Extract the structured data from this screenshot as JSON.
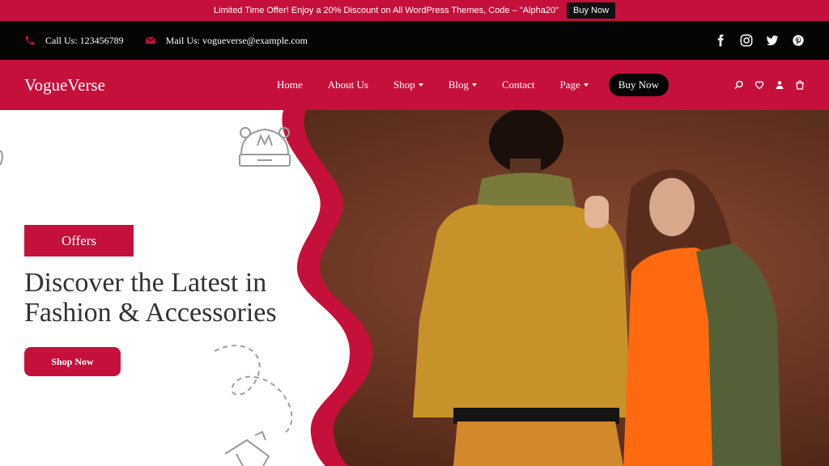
{
  "promo": {
    "text": "Limited Time Offer! Enjoy a 20% Discount on All WordPress Themes, Code – \"Alpha20\"",
    "button": "Buy Now"
  },
  "topbar": {
    "phone": "Call Us: 123456789",
    "email": "Mail Us: vogueverse@example.com",
    "social": [
      "facebook-icon",
      "instagram-icon",
      "twitter-icon",
      "pinterest-icon"
    ]
  },
  "header": {
    "logo": "VogueVerse",
    "nav": [
      {
        "label": "Home"
      },
      {
        "label": "About Us"
      },
      {
        "label": "Shop"
      },
      {
        "label": "Blog"
      },
      {
        "label": "Contact"
      },
      {
        "label": "Page"
      }
    ],
    "cta": "Buy Now",
    "icons": [
      "search-icon",
      "heart-icon",
      "user-icon",
      "cart-icon"
    ]
  },
  "hero": {
    "badge": "Offers",
    "headline": "Discover the Latest in Fashion & Accessories",
    "button": "Shop Now"
  },
  "colors": {
    "brand": "#c5103c",
    "dark": "#050505",
    "text": "#333333"
  }
}
